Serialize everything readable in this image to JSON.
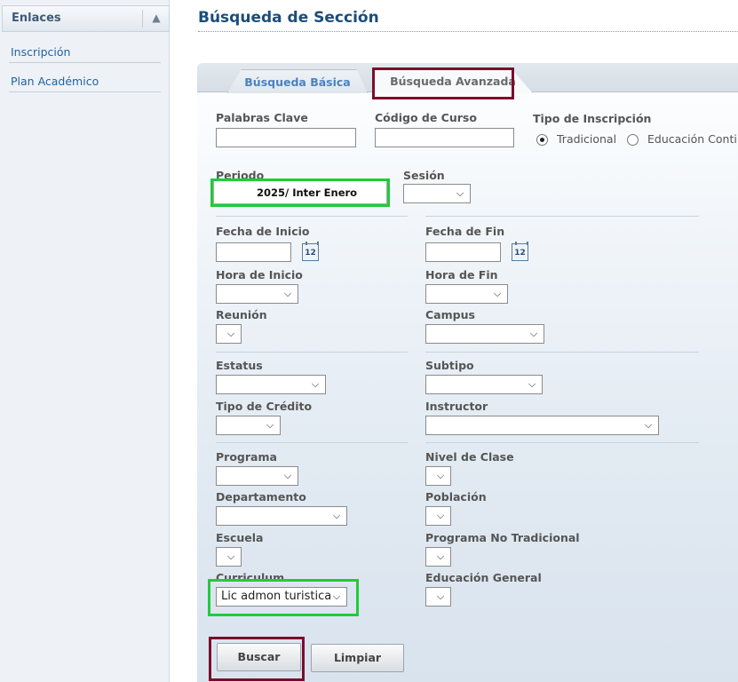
{
  "sidebar": {
    "title": "Enlaces",
    "items": [
      {
        "label": "Inscripción"
      },
      {
        "label": "Plan Académico"
      }
    ]
  },
  "page": {
    "title": "Búsqueda de Sección"
  },
  "tabs": [
    {
      "label": "Búsqueda Básica",
      "active": false
    },
    {
      "label": "Búsqueda Avanzada",
      "active": true
    }
  ],
  "form": {
    "keywords": {
      "label": "Palabras Clave",
      "value": ""
    },
    "course_code": {
      "label": "Código de Curso",
      "value": ""
    },
    "enrollment_type": {
      "label": "Tipo de Inscripción",
      "options": [
        "Tradicional",
        "Educación Contin"
      ],
      "selected": "Tradicional"
    },
    "period": {
      "label": "Periodo",
      "value": "2025/ Inter Enero"
    },
    "session": {
      "label": "Sesión",
      "value": ""
    },
    "start_date": {
      "label": "Fecha de Inicio",
      "value": "",
      "calendar_text": "12"
    },
    "end_date": {
      "label": "Fecha de Fin",
      "value": "",
      "calendar_text": "12"
    },
    "start_time": {
      "label": "Hora de Inicio",
      "value": ""
    },
    "end_time": {
      "label": "Hora de Fin",
      "value": ""
    },
    "meeting": {
      "label": "Reunión",
      "value": ""
    },
    "campus": {
      "label": "Campus",
      "value": ""
    },
    "status": {
      "label": "Estatus",
      "value": ""
    },
    "subtype": {
      "label": "Subtipo",
      "value": ""
    },
    "credit_type": {
      "label": "Tipo de Crédito",
      "value": ""
    },
    "instructor": {
      "label": "Instructor",
      "value": ""
    },
    "program": {
      "label": "Programa",
      "value": ""
    },
    "class_level": {
      "label": "Nivel de Clase",
      "value": ""
    },
    "department": {
      "label": "Departamento",
      "value": ""
    },
    "population": {
      "label": "Población",
      "value": ""
    },
    "school": {
      "label": "Escuela",
      "value": ""
    },
    "non_traditional_program": {
      "label": "Programa No Tradicional",
      "value": ""
    },
    "curriculum": {
      "label": "Curriculum",
      "value": "Lic admon turistica"
    },
    "general_education": {
      "label": "Educación General",
      "value": ""
    }
  },
  "buttons": {
    "search": "Buscar",
    "clear": "Limpiar"
  },
  "colors": {
    "highlight_red": "#7a0e2a",
    "highlight_green": "#1fcc3b",
    "title_blue": "#1a4d7c"
  }
}
